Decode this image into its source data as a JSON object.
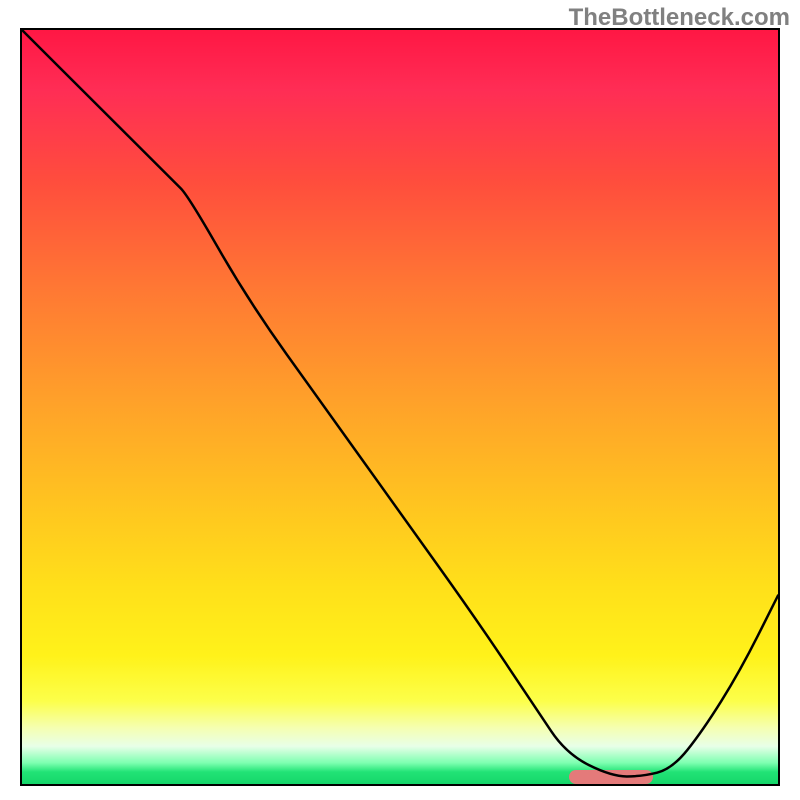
{
  "watermark": "TheBottleneck.com",
  "chart_data": {
    "type": "line",
    "title": "",
    "xlabel": "",
    "ylabel": "",
    "xlim": [
      0,
      100
    ],
    "ylim": [
      0,
      100
    ],
    "grid": false,
    "series": [
      {
        "name": "bottleneck-curve",
        "x": [
          0,
          10,
          20,
          22,
          30,
          40,
          50,
          60,
          68,
          72,
          78,
          82,
          86,
          90,
          95,
          100
        ],
        "values": [
          100,
          90,
          80,
          78,
          64,
          50,
          36,
          22,
          10,
          4,
          1,
          1,
          2,
          7,
          15,
          25
        ]
      }
    ],
    "marker": {
      "x_start": 72,
      "x_end": 83,
      "y": 1.4,
      "color": "#e47a7a"
    },
    "background": "red-yellow-green vertical gradient"
  }
}
